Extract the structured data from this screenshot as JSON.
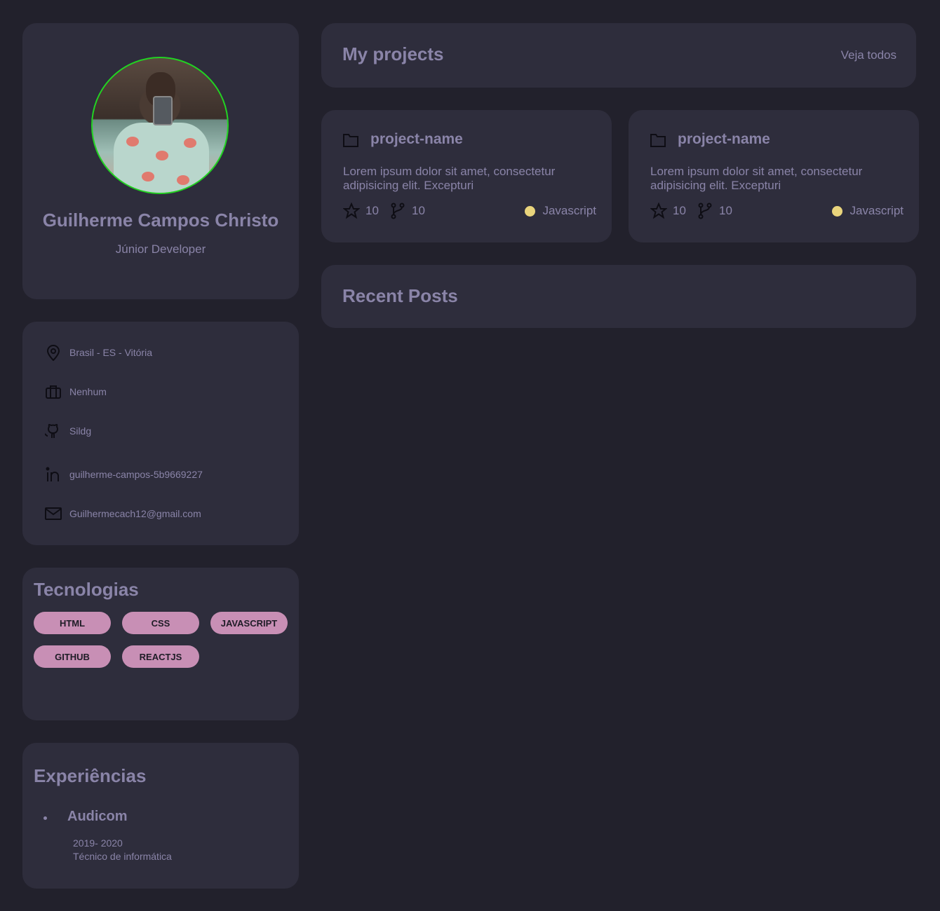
{
  "profile": {
    "name": "Guilherme Campos Christo",
    "role": "Júnior Developer"
  },
  "info": {
    "location": "Brasil - ES - Vitória",
    "company": "Nenhum",
    "github": "Sildg",
    "linkedin": "guilherme-campos-5b9669227",
    "email": "Guilhermecach12@gmail.com"
  },
  "tech": {
    "title": "Tecnologias",
    "items": [
      "HTML",
      "CSS",
      "JAVASCRIPT",
      "GITHUB",
      "REACTJS"
    ]
  },
  "experience": {
    "title": "Experiências",
    "items": [
      {
        "company": "Audicom",
        "period": "2019- 2020",
        "role": "Técnico de informática"
      }
    ]
  },
  "projects": {
    "title": "My projects",
    "see_all": "Veja todos",
    "items": [
      {
        "name": "project-name",
        "description": "Lorem ipsum dolor sit amet, consectetur adipisicing elit. Excepturi",
        "stars": "10",
        "forks": "10",
        "language": "Javascript"
      },
      {
        "name": "project-name",
        "description": "Lorem ipsum dolor sit amet, consectetur adipisicing elit. Excepturi",
        "stars": "10",
        "forks": "10",
        "language": "Javascript"
      }
    ]
  },
  "posts": {
    "title": "Recent Posts"
  },
  "colors": {
    "background": "#22212c",
    "card": "#2e2d3c",
    "text": "#8a84a8",
    "chip": "#c88fb5",
    "avatar_ring": "#22d322",
    "language_dot": "#e9d47c"
  }
}
